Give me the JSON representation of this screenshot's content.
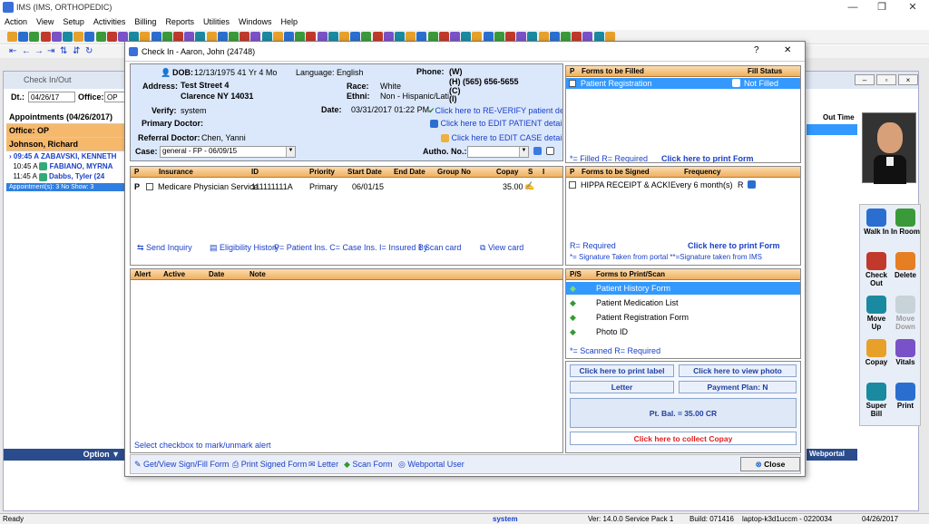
{
  "app": {
    "title": "IMS (IMS, ORTHOPEDIC)",
    "minimize": "—",
    "restore": "❐",
    "close": "✕"
  },
  "menu": [
    "Action",
    "View",
    "Setup",
    "Activities",
    "Billing",
    "Reports",
    "Utilities",
    "Windows",
    "Help"
  ],
  "checkinout": {
    "title": "Check In/Out",
    "dt_label": "Dt.:",
    "dt_value": "04/26/17",
    "office_label": "Office:",
    "office_value": "OP",
    "appt_header": "Appointments (04/26/2017)",
    "office_row": "Office: OP",
    "doctor_row": "Johnson, Richard",
    "appts": [
      {
        "time": "09:45 A",
        "name": "ZABAVSKI, KENNETH"
      },
      {
        "time": "10:45 A",
        "name": "FABIANO, MYRNA"
      },
      {
        "time": "11:45 A",
        "name": "Dabbs, Tyler (24"
      }
    ],
    "appt_summary": "Appointment(s): 3   No Show: 3",
    "col_me": "me",
    "col_out": "Out Time",
    "option_label": "Option",
    "webportal_label": "Webportal User"
  },
  "side_buttons": [
    {
      "label": "Walk In",
      "icon": "walk-in-icon"
    },
    {
      "label": "In Room",
      "icon": "in-room-icon"
    },
    {
      "label": "Check Out",
      "icon": "check-out-icon"
    },
    {
      "label": "Delete",
      "icon": "delete-icon"
    },
    {
      "label": "Move Up",
      "icon": "move-up-icon"
    },
    {
      "label": "Move Down",
      "icon": "move-down-icon"
    },
    {
      "label": "Copay",
      "icon": "copay-icon"
    },
    {
      "label": "Vitals",
      "icon": "vitals-icon"
    },
    {
      "label": "Super Bill",
      "icon": "super-bill-icon"
    },
    {
      "label": "Print",
      "icon": "print-icon"
    }
  ],
  "modal": {
    "title": "Check In - Aaron, John  (24748)",
    "help": "?",
    "close": "✕",
    "patient": {
      "dob_label": "DOB:",
      "dob": "12/13/1975  41 Yr 4 Mo",
      "language": "Language: English",
      "phone_label": "Phone:",
      "phone_w": "(W)",
      "phone_h": "(H)  (565) 656-5655",
      "phone_c": "(C)",
      "phone_i": "(I)",
      "address_label": "Address:",
      "address1": "Test Street 4",
      "address2": "Clarence  NY  14031",
      "race_label": "Race:",
      "race": "White",
      "ethni_label": "Ethni:",
      "ethni": "Non - Hispanic/Lati",
      "verify_label": "Verify:",
      "verify": "system",
      "date_label": "Date:",
      "date": "03/31/2017 01:22 PM",
      "reverify": "Click here to RE-VERIFY patient detail",
      "edit_patient": "Click here to EDIT PATIENT detail",
      "edit_case": "Click here to EDIT CASE detail",
      "primary_doctor_label": "Primary Doctor:",
      "referral_label": "Referral Doctor:",
      "referral": "Chen, Yanni",
      "case_label": "Case:",
      "case_value": "general  - FP - 06/09/15",
      "autho_label": "Autho. No.:"
    },
    "insurance": {
      "headers": [
        "P",
        "Insurance",
        "ID",
        "Priority",
        "Start Date",
        "End Date",
        "Group No",
        "Copay",
        "S",
        "I"
      ],
      "rows": [
        {
          "p": "P",
          "insurance": "Medicare Physician Service",
          "id": "111111111A",
          "priority": "Primary",
          "start": "06/01/15",
          "end": "",
          "group": "",
          "copay": "35.00"
        }
      ],
      "links": [
        "Send Inquiry",
        "Eligibility History",
        "P= Patient Ins. C= Case Ins.  I= Insured By",
        "Scan card",
        "View card"
      ]
    },
    "alerts": {
      "headers": [
        "Alert",
        "Active",
        "Date",
        "Note"
      ],
      "footer": "Select checkbox to mark/unmark alert"
    },
    "forms_fill": {
      "headers": [
        "P",
        "Forms to be Filled",
        "Fill Status"
      ],
      "rows": [
        {
          "name": "Patient Registration",
          "status": "Not Filled"
        }
      ],
      "legend": "*= Filled  R= Required",
      "print": "Click here to print Form"
    },
    "forms_sign": {
      "headers": [
        "P",
        "Forms to be Signed",
        "Frequency"
      ],
      "rows": [
        {
          "name": "HIPPA RECEIPT & ACKNOWLE",
          "freq": "Every 6 month(s)",
          "r": "R"
        }
      ],
      "legend1": "R= Required",
      "print": "Click here to print Form",
      "legend2": "*= Signature Taken from portal  **=Signature taken from IMS"
    },
    "forms_scan": {
      "headers": [
        "P/S",
        "Forms to Print/Scan"
      ],
      "rows": [
        "Patient History Form",
        "Patient Medication List",
        "Patient Registration Form",
        "Photo ID"
      ],
      "legend": "*= Scanned   R= Required"
    },
    "actions": {
      "print_label": "Click here to print label",
      "view_photo": "Click here to view photo",
      "letter": "Letter",
      "payment_plan": "Payment Plan: N",
      "balance": "Pt. Bal. = 35.00 CR",
      "collect": "Click here to collect Copay"
    },
    "bottom": [
      "Get/View Sign/Fill Form",
      "Print Signed Form",
      "Letter",
      "Scan Form",
      "Webportal User"
    ],
    "close_btn": "Close"
  },
  "statusbar": {
    "ready": "Ready",
    "user": "system",
    "version": "Ver: 14.0.0 Service Pack 1",
    "build": "Build: 071416",
    "machine": "laptop-k3d1uccm - 0220034",
    "date": "04/26/2017"
  }
}
